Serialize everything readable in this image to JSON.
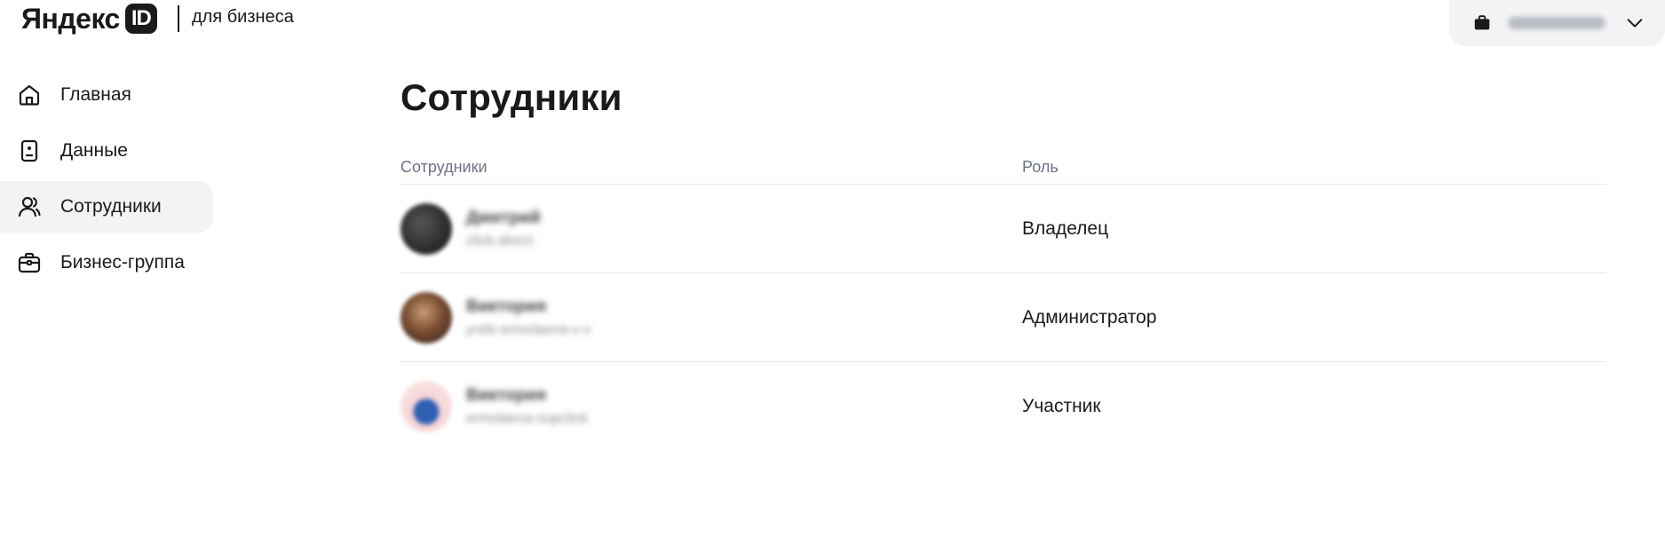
{
  "brand": {
    "logo_word": "Яндекс",
    "logo_id": "ID",
    "subtitle": "для бизнеса"
  },
  "account": {
    "icon": "briefcase-icon",
    "name_obscured": true
  },
  "sidebar": {
    "items": [
      {
        "label": "Главная",
        "icon": "home-icon",
        "active": false
      },
      {
        "label": "Данные",
        "icon": "id-card-icon",
        "active": false
      },
      {
        "label": "Сотрудники",
        "icon": "users-icon",
        "active": true
      },
      {
        "label": "Бизнес-группа",
        "icon": "briefcase-icon",
        "active": false
      }
    ]
  },
  "main": {
    "title": "Сотрудники",
    "columns": [
      "Сотрудники",
      "Роль"
    ],
    "rows": [
      {
        "name": "Дмитрий",
        "login": "click-direct",
        "role": "Владелец",
        "avatar_color": "#3a3a3a"
      },
      {
        "name": "Виктория",
        "login": "yndx-ermolaeva-v-v",
        "role": "Администратор",
        "avatar_color": "#6b4a35"
      },
      {
        "name": "Виктория",
        "login": "ermolaeva-supclick",
        "role": "Участник",
        "avatar_color": "#2f5fb3"
      }
    ]
  },
  "colors": {
    "active_bg": "#f2f3f5",
    "header_text": "#6c7185",
    "divider": "#e6e7ea"
  }
}
